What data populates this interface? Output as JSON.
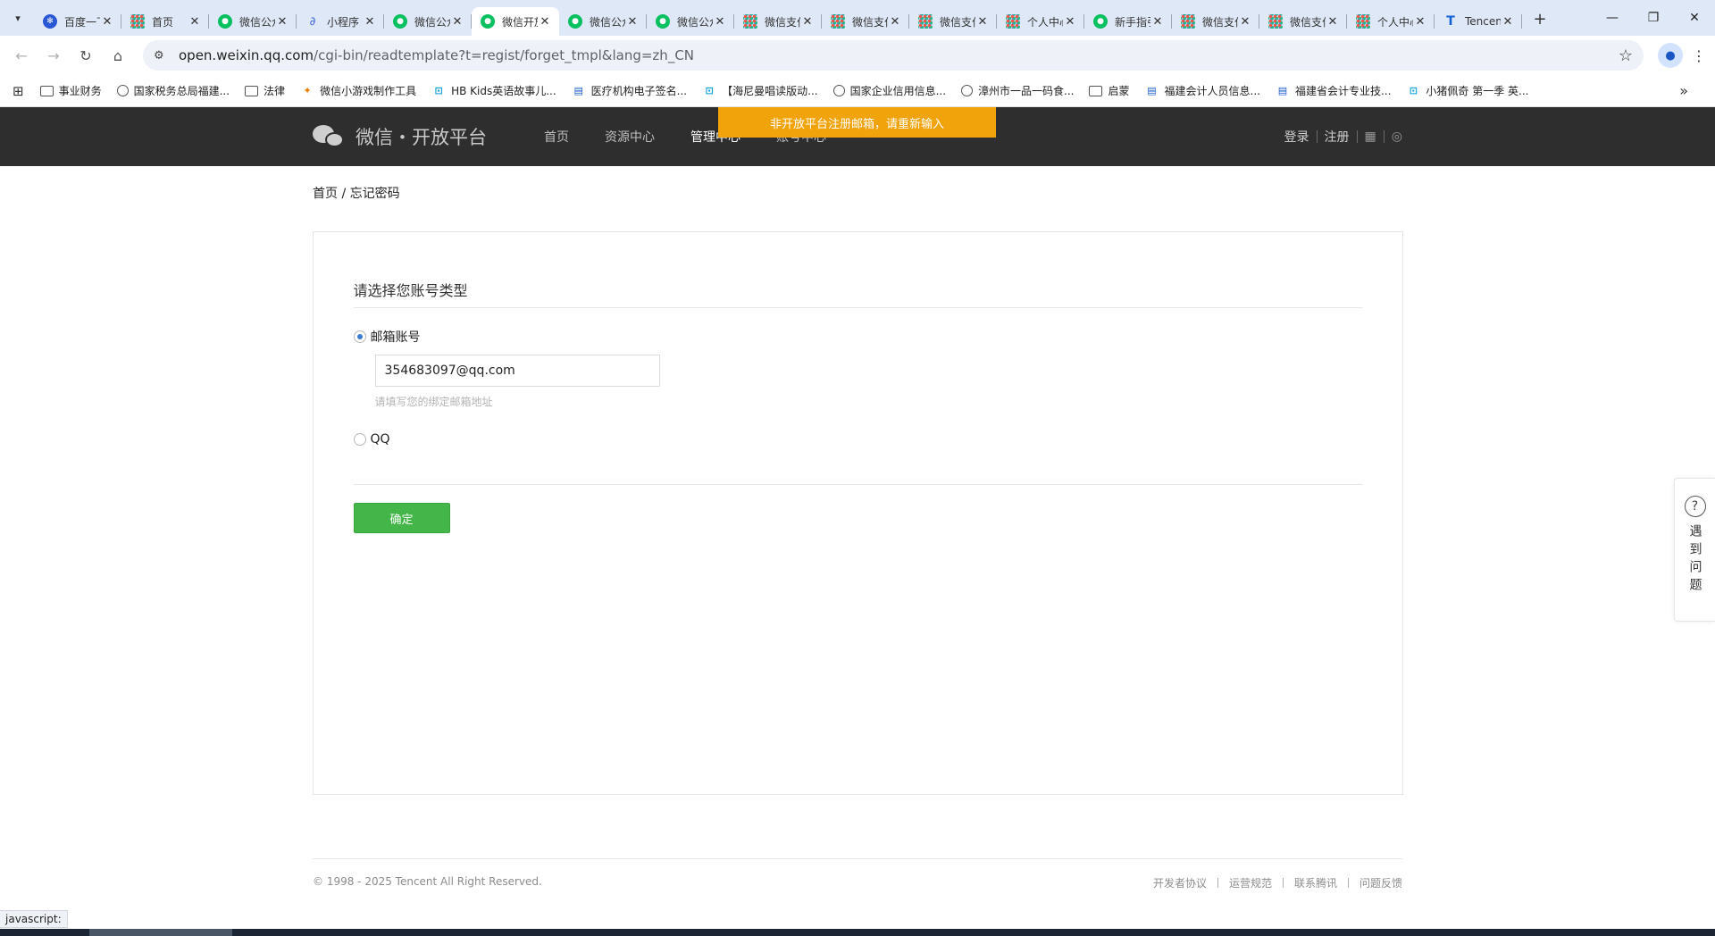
{
  "browser": {
    "tabs": [
      {
        "title": "百度一下",
        "icon": "baidu-icon",
        "active": false
      },
      {
        "title": "首页",
        "icon": "grid-icon",
        "active": false
      },
      {
        "title": "微信公众平台",
        "icon": "wechat-icon",
        "active": false
      },
      {
        "title": "小程序",
        "icon": "link-icon",
        "active": false
      },
      {
        "title": "微信公众平台",
        "icon": "wechat-icon",
        "active": false
      },
      {
        "title": "微信开放平台",
        "icon": "wechat-icon",
        "active": true
      },
      {
        "title": "微信公众平台",
        "icon": "wechat-icon",
        "active": false
      },
      {
        "title": "微信公众平台",
        "icon": "wechat-icon",
        "active": false
      },
      {
        "title": "微信支付",
        "icon": "grid-icon",
        "active": false
      },
      {
        "title": "微信支付",
        "icon": "grid-icon",
        "active": false
      },
      {
        "title": "微信支付",
        "icon": "grid-icon",
        "active": false
      },
      {
        "title": "个人中心",
        "icon": "grid-icon",
        "active": false
      },
      {
        "title": "新手指引",
        "icon": "wechat-icon",
        "active": false
      },
      {
        "title": "微信支付",
        "icon": "grid-icon",
        "active": false
      },
      {
        "title": "微信支付",
        "icon": "grid-icon",
        "active": false
      },
      {
        "title": "个人中心",
        "icon": "grid-icon",
        "active": false
      },
      {
        "title": "Tencent",
        "icon": "tencent-icon",
        "active": false
      }
    ],
    "url_host": "open.weixin.qq.com",
    "url_path": "/cgi-bin/readtemplate?t=regist/forget_tmpl&lang=zh_CN",
    "bookmarks": [
      {
        "label": "事业财务",
        "icon": "folder"
      },
      {
        "label": "国家税务总局福建...",
        "icon": "globe"
      },
      {
        "label": "法律",
        "icon": "folder"
      },
      {
        "label": "微信小游戏制作工具",
        "icon": "fire"
      },
      {
        "label": "HB Kids英语故事儿...",
        "icon": "tv"
      },
      {
        "label": "医疗机构电子签名...",
        "icon": "blue"
      },
      {
        "label": "【海尼曼唱读版动...",
        "icon": "tv"
      },
      {
        "label": "国家企业信用信息...",
        "icon": "globe"
      },
      {
        "label": "漳州市一品一码食...",
        "icon": "globe"
      },
      {
        "label": "启蒙",
        "icon": "folder"
      },
      {
        "label": "福建会计人员信息...",
        "icon": "blue"
      },
      {
        "label": "福建省会计专业技...",
        "icon": "blue"
      },
      {
        "label": "小猪佩奇 第一季 英...",
        "icon": "tv"
      }
    ]
  },
  "site": {
    "logo_text": "微信・开放平台",
    "nav": [
      {
        "label": "首页",
        "current": false
      },
      {
        "label": "资源中心",
        "current": false
      },
      {
        "label": "管理中心",
        "current": true
      },
      {
        "label": "账号中心",
        "current": false
      }
    ],
    "login": "登录",
    "register": "注册",
    "alert": "非开放平台注册邮箱，请重新输入"
  },
  "breadcrumb": {
    "home": "首页",
    "sep": "/",
    "current": "忘记密码"
  },
  "form": {
    "title": "请选择您账号类型",
    "option_email": "邮箱账号",
    "email_value": "354683097@qq.com",
    "email_hint": "请填写您的绑定邮箱地址",
    "option_qq": "QQ",
    "confirm": "确定"
  },
  "footer": {
    "copyright": "© 1998 - 2025 Tencent All Right Reserved.",
    "links": [
      "开发者协议",
      "运营规范",
      "联系腾讯",
      "问题反馈"
    ]
  },
  "help": {
    "text": "遇到问题",
    "icon": "question-icon"
  },
  "status_tip": "javascript:",
  "colors": {
    "accent_green": "#44b549",
    "alert_orange": "#f0a30a",
    "header_bg": "#2e2e2e"
  }
}
